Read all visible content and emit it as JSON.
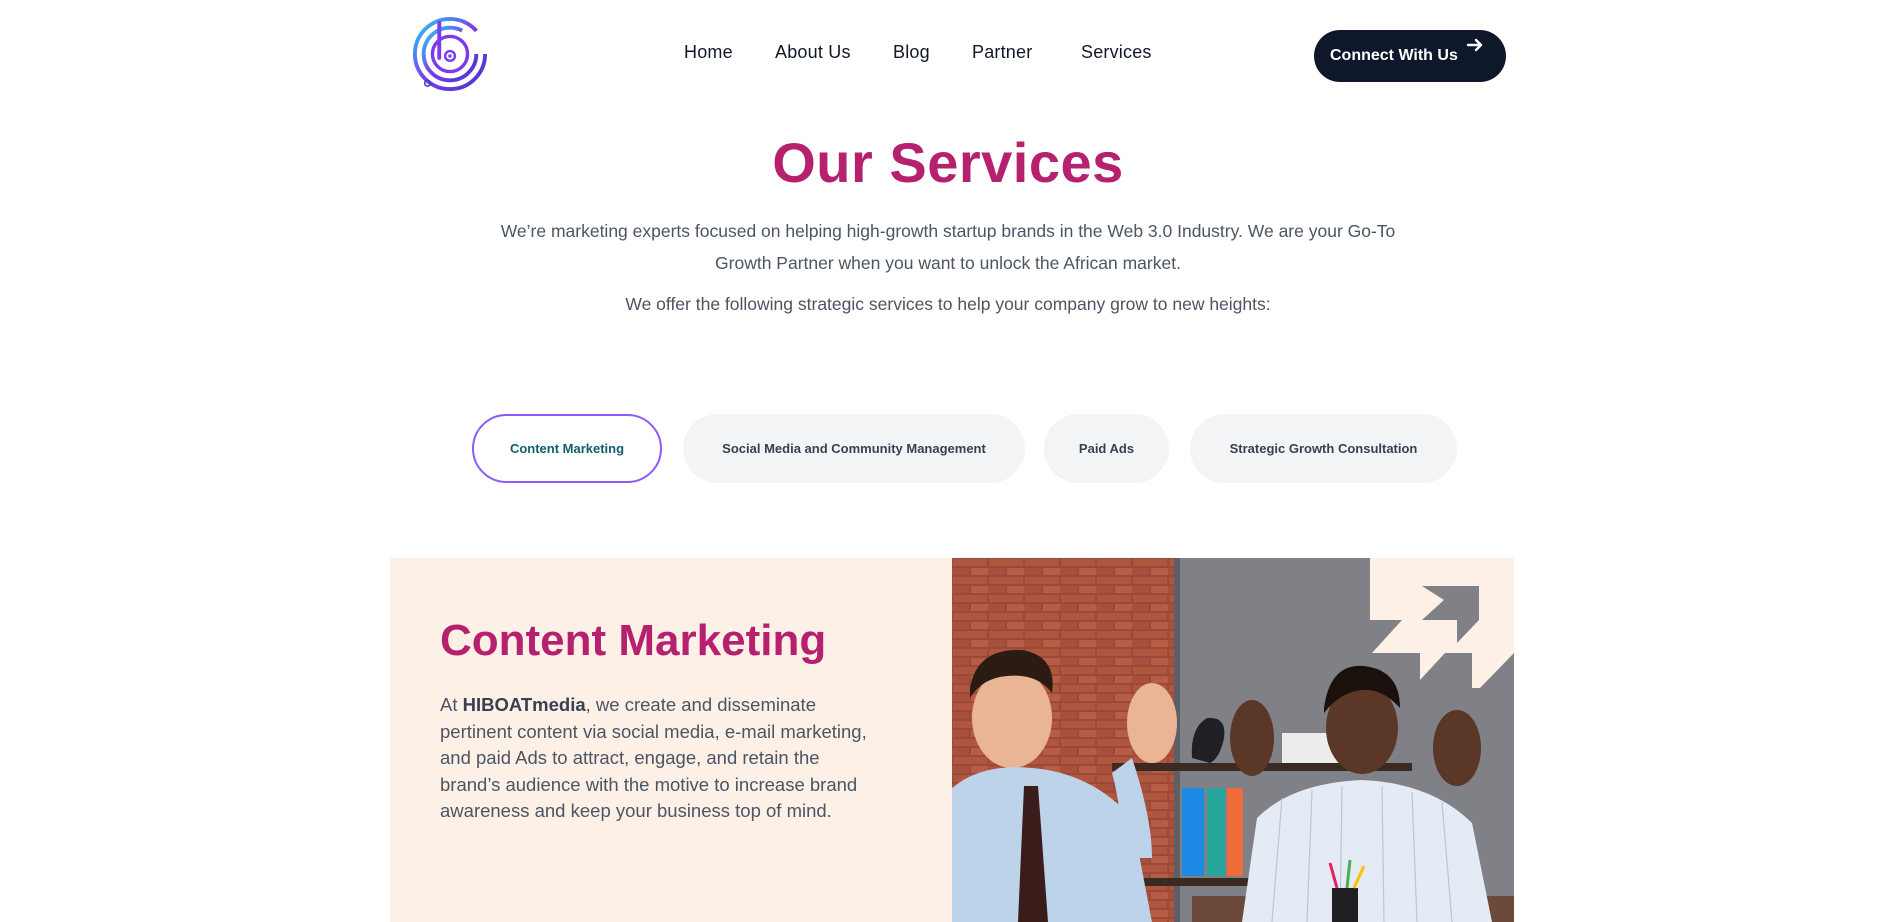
{
  "header": {
    "logo_name": "hiboat-logo",
    "nav": [
      {
        "label": "Home"
      },
      {
        "label": "About Us"
      },
      {
        "label": "Blog"
      },
      {
        "label": "Partner"
      },
      {
        "label": "Services"
      }
    ],
    "cta_label": "Connect With Us"
  },
  "hero": {
    "title": "Our Services",
    "intro": "We’re marketing experts focused on helping high-growth startup brands in the Web 3.0 Industry. We are your Go-To Growth Partner when you want to unlock the African market.",
    "intro2": "We offer the following strategic services to help your company grow to new heights:"
  },
  "tabs": [
    {
      "label": "Content Marketing",
      "active": true
    },
    {
      "label": "Social Media and Community Management",
      "active": false
    },
    {
      "label": "Paid Ads",
      "active": false
    },
    {
      "label": "Strategic Growth Consultation",
      "active": false
    }
  ],
  "panel": {
    "title": "Content Marketing",
    "body_prefix": "At ",
    "body_brand": "HIBOATmedia",
    "body_rest": ", we create and disseminate pertinent content via social media, e-mail marketing, and paid Ads to attract, engage, and retain the brand’s audience with the motive to increase brand awareness and keep your business top of mind.",
    "image_name": "two-men-celebrating-photo"
  },
  "colors": {
    "accent": "#b5206f",
    "dark": "#0f172a",
    "tab_active_border": "#8b5cf6",
    "panel_bg": "#fdf0e7"
  }
}
